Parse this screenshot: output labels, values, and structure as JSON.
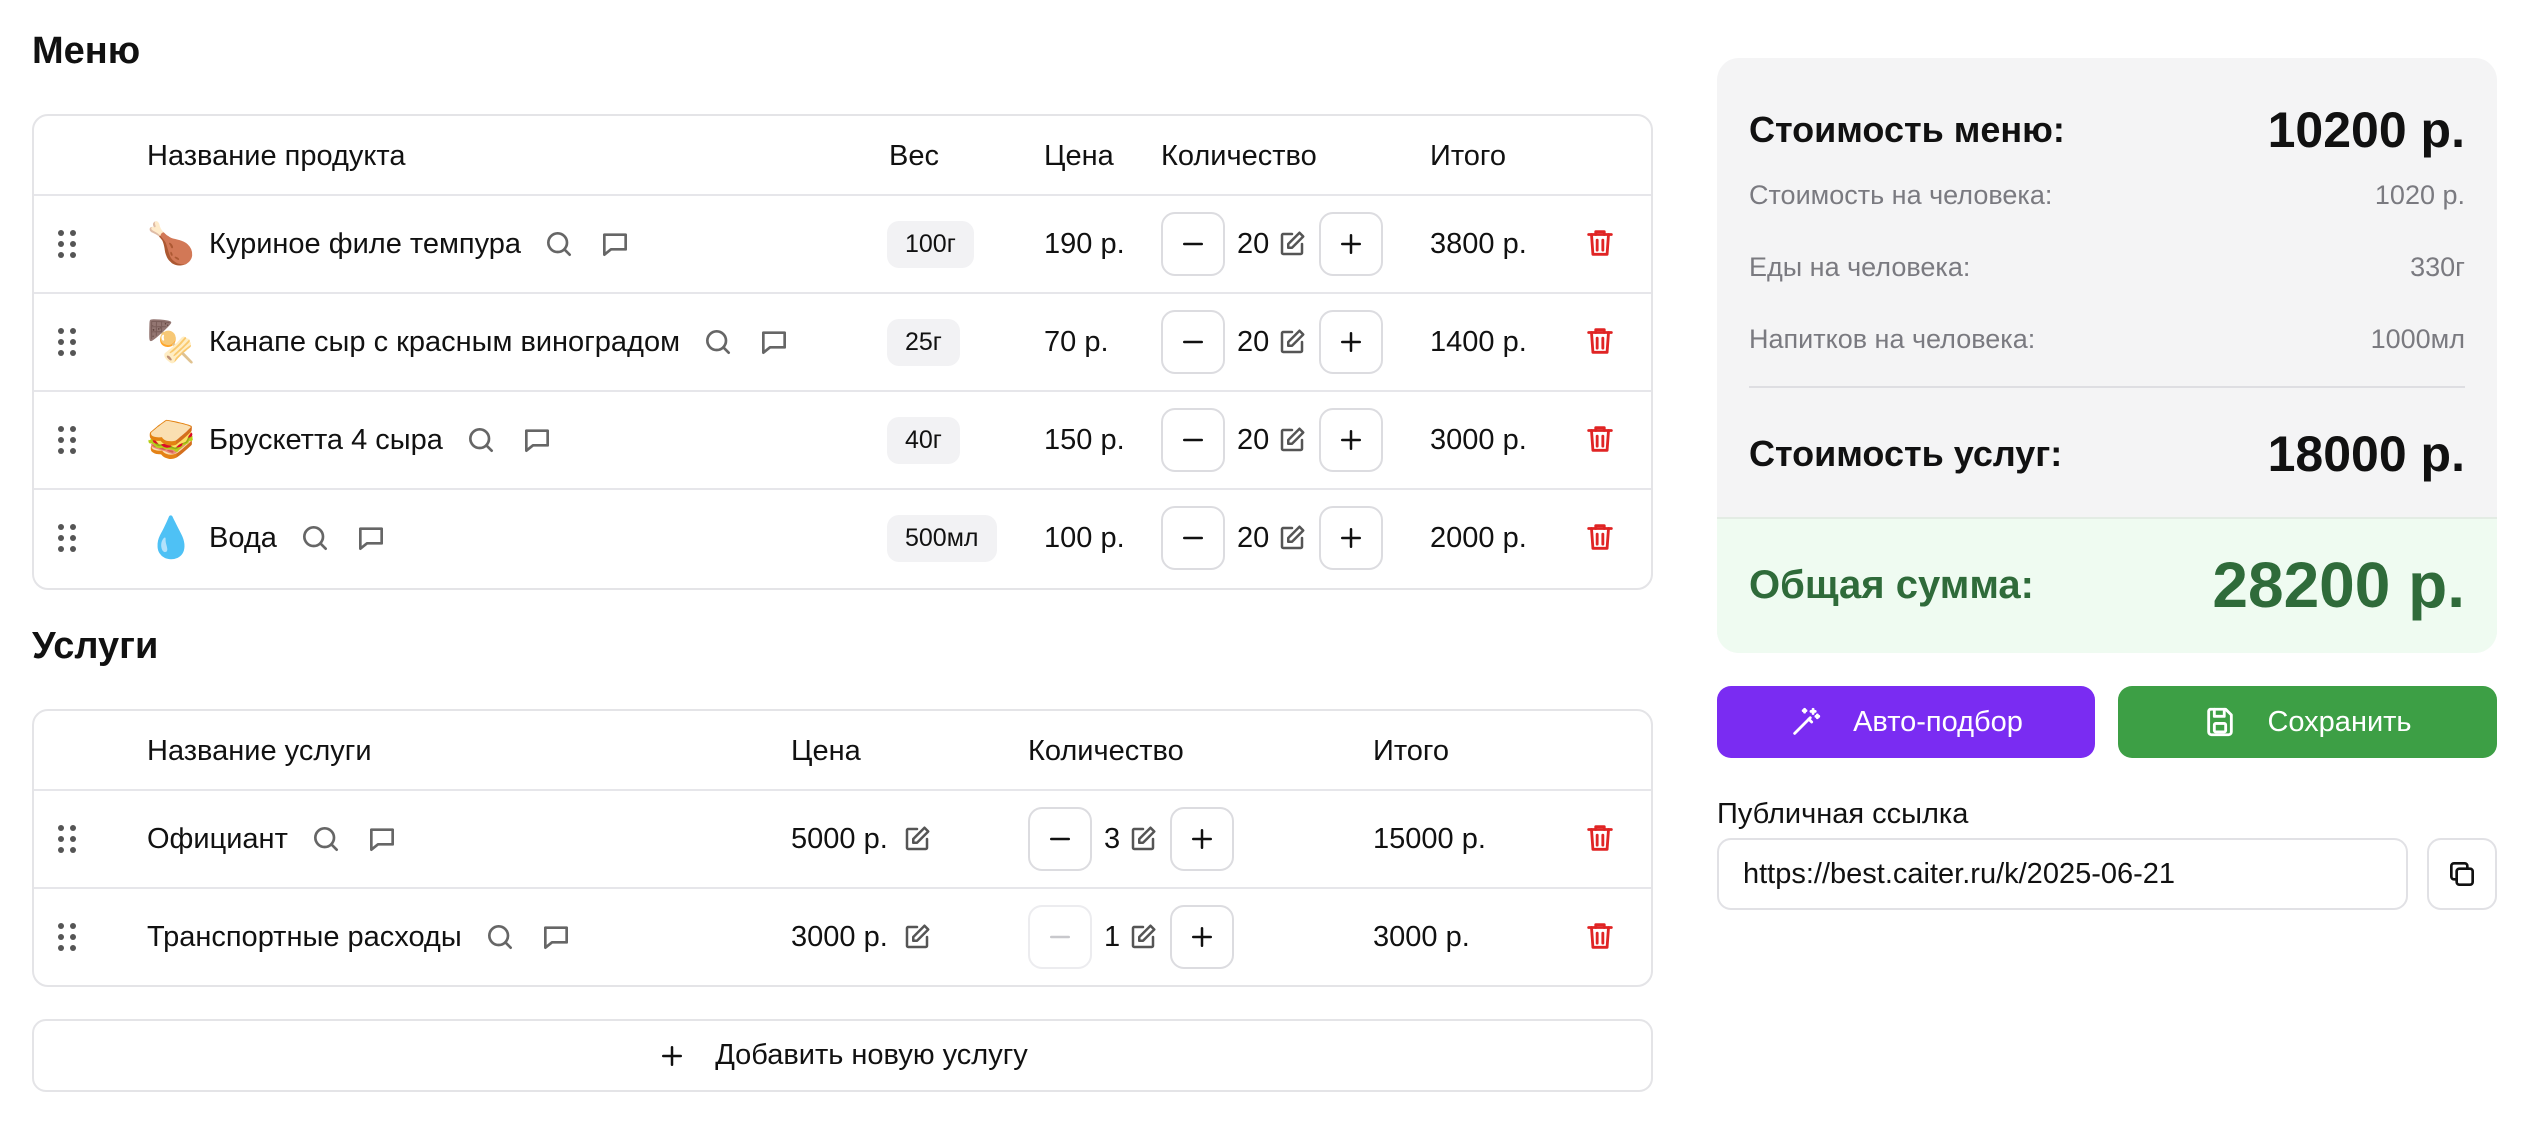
{
  "menu": {
    "title": "Меню",
    "headers": {
      "name": "Название продукта",
      "weight": "Вес",
      "price": "Цена",
      "qty": "Количество",
      "total": "Итого"
    },
    "items": [
      {
        "emoji": "🍗",
        "name": "Куриное филе темпура",
        "weight": "100г",
        "price": "190 р.",
        "qty": "20",
        "total": "3800 р."
      },
      {
        "emoji": "🍢",
        "name": "Канапе сыр с красным виноградом",
        "weight": "25г",
        "price": "70 р.",
        "qty": "20",
        "total": "1400 р."
      },
      {
        "emoji": "🥪",
        "name": "Брускетта 4 сыра",
        "weight": "40г",
        "price": "150 р.",
        "qty": "20",
        "total": "3000 р."
      },
      {
        "emoji": "💧",
        "name": "Вода",
        "weight": "500мл",
        "price": "100 р.",
        "qty": "20",
        "total": "2000 р."
      }
    ]
  },
  "services": {
    "title": "Услуги",
    "headers": {
      "name": "Название услуги",
      "price": "Цена",
      "qty": "Количество",
      "total": "Итого"
    },
    "items": [
      {
        "name": "Официант",
        "price": "5000 р.",
        "qty": "3",
        "total": "15000 р.",
        "minus_disabled": false
      },
      {
        "name": "Транспортные расходы",
        "price": "3000 р.",
        "qty": "1",
        "total": "3000 р.",
        "minus_disabled": true
      }
    ],
    "add_label": "Добавить новую услугу"
  },
  "summary": {
    "menu_cost_label": "Стоимость меню:",
    "menu_cost_value": "10200 р.",
    "per_person_label": "Стоимость на человека:",
    "per_person_value": "1020 р.",
    "food_label": "Еды на человека:",
    "food_value": "330г",
    "drinks_label": "Напитков на человека:",
    "drinks_value": "1000мл",
    "services_cost_label": "Стоимость услуг:",
    "services_cost_value": "18000 р.",
    "total_label": "Общая сумма:",
    "total_value": "28200 р."
  },
  "actions": {
    "auto_label": "Авто-подбор",
    "save_label": "Сохранить"
  },
  "public_link": {
    "label": "Публичная ссылка",
    "value": "https://best.caiter.ru/k/2025-06-21"
  },
  "colors": {
    "purple": "#7a2cf2",
    "green": "#3d9f45",
    "red": "#e02424",
    "total_green": "#2f6b3a"
  },
  "icons": {
    "drag": "drag-handle-icon",
    "search": "search-icon",
    "comment": "comment-icon",
    "edit": "edit-icon",
    "trash": "trash-icon",
    "minus": "minus-icon",
    "plus": "plus-icon",
    "wand": "magic-wand-icon",
    "save": "save-icon",
    "copy": "copy-icon"
  }
}
